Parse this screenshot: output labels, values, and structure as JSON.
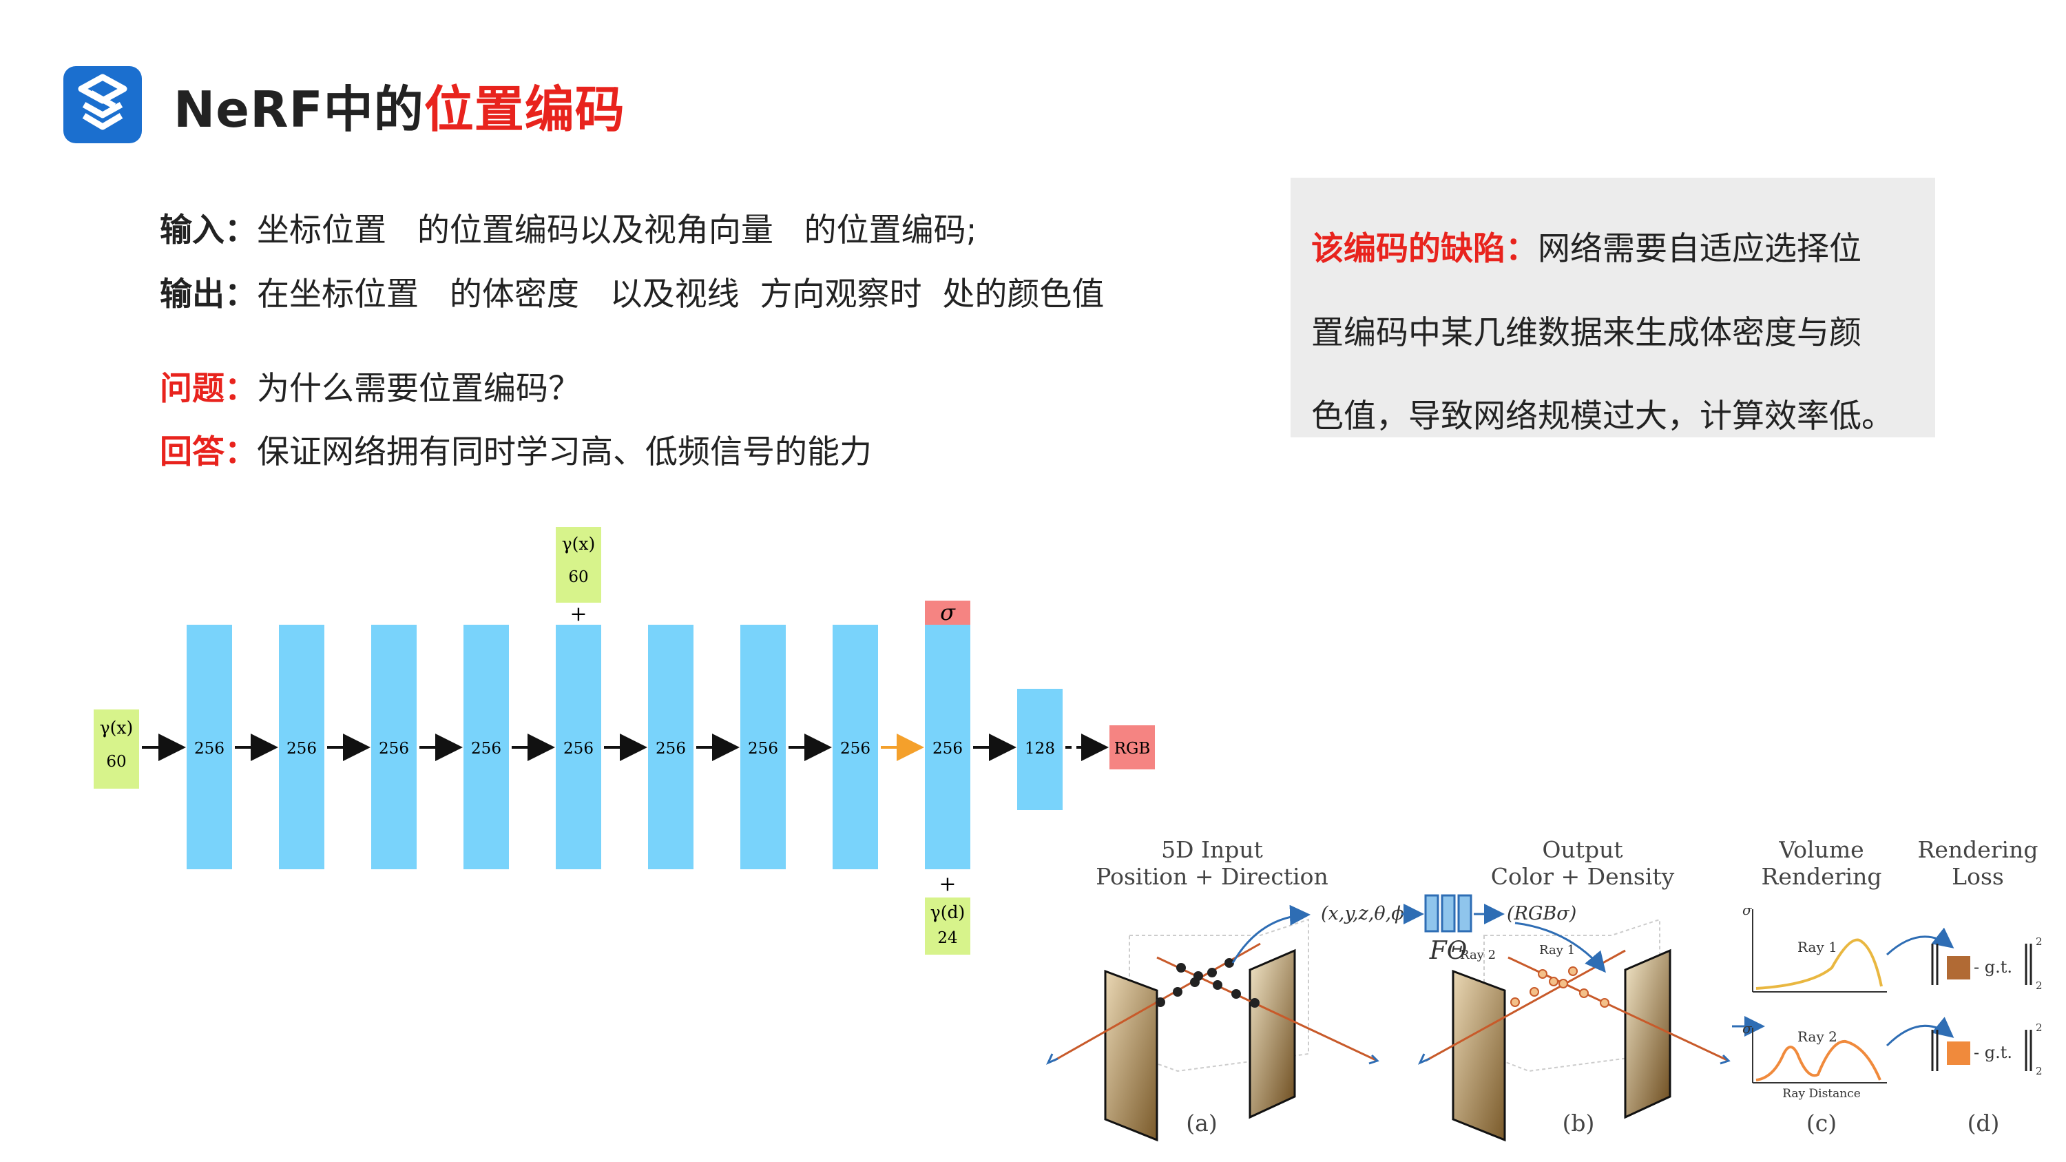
{
  "header": {
    "title_prefix": "NeRF中的",
    "title_highlight": "位置编码",
    "colors": {
      "accent_red": "#e8231d",
      "logo_blue": "#1b6fcf"
    }
  },
  "text_block": {
    "input_key": "输入：",
    "input_text": "坐标位置   的位置编码以及视角向量   的位置编码;",
    "output_key": "输出：",
    "output_text": "在坐标位置   的体密度   以及视线  方向观察时  处的颜色值",
    "question_key": "问题：",
    "question_text": "为什么需要位置编码？",
    "answer_key": "回答：",
    "answer_text": "保证网络拥有同时学习高、低频信号的能力"
  },
  "defect": {
    "key": "该编码的缺陷：",
    "line1": "网络需要自适应选择位",
    "line2": "置编码中某几维数据来生成体密度与颜",
    "line3": "色值，导致网络规模过大，计算效率低。",
    "background": "#ececec"
  },
  "mlp": {
    "input_x_label": "γ(x)",
    "input_x_dim": "60",
    "inject_x_label": "γ(x)",
    "inject_x_dim": "60",
    "inject_d_label": "γ(d)",
    "inject_d_dim": "24",
    "plus": "+",
    "sigma": "σ",
    "rgb": "RGB",
    "layers": [
      "256",
      "256",
      "256",
      "256",
      "256",
      "256",
      "256",
      "256",
      "256",
      "128"
    ],
    "colors": {
      "layer": "#79d3fb",
      "input": "#d7f38b",
      "output": "#f58482",
      "orange_arrow": "#f4a02b"
    }
  },
  "pipeline": {
    "a_title1": "5D Input",
    "a_title2": "Position + Direction",
    "b_title1": "Output",
    "b_title2": "Color + Density",
    "c_title1": "Volume",
    "c_title2": "Rendering",
    "d_title1": "Rendering",
    "d_title2": "Loss",
    "input_tuple": "(x,y,z,θ,ϕ)",
    "network_label": "FΘ",
    "output_tuple": "(RGBσ)",
    "ray1": "Ray 1",
    "ray2": "Ray 2",
    "ray_distance": "Ray Distance",
    "sigma_axis": "σ",
    "gt": "- g.t.",
    "norm_sup": "2",
    "norm_sub": "2",
    "cap_a": "(a)",
    "cap_b": "(b)",
    "cap_c": "(c)",
    "cap_d": "(d)"
  }
}
